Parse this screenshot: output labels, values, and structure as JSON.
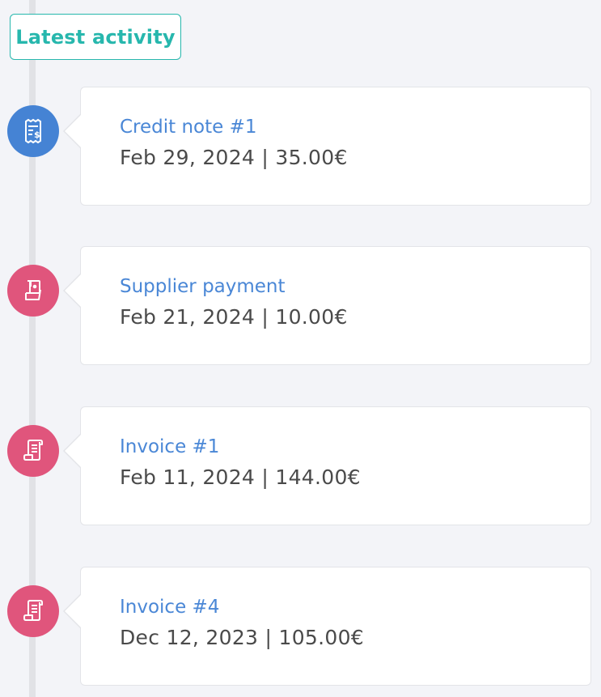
{
  "header": {
    "title": "Latest activity"
  },
  "colors": {
    "accent": "#27b7ad",
    "blue_icon": "#4583d4",
    "pink_icon": "#e0557c",
    "link": "#4a87d6",
    "text": "#4a4a4a"
  },
  "activities": [
    {
      "icon": "receipt-dollar-icon",
      "icon_color": "#4583d4",
      "title": "Credit note #1",
      "date": "Feb 29, 2024",
      "separator": "|",
      "amount": "35.00€"
    },
    {
      "icon": "hand-money-icon",
      "icon_color": "#e0557c",
      "title": "Supplier payment",
      "date": "Feb 21, 2024",
      "separator": "|",
      "amount": "10.00€"
    },
    {
      "icon": "scroll-invoice-icon",
      "icon_color": "#e0557c",
      "title": "Invoice #1",
      "date": "Feb 11, 2024",
      "separator": "|",
      "amount": "144.00€"
    },
    {
      "icon": "scroll-invoice-icon",
      "icon_color": "#e0557c",
      "title": "Invoice #4",
      "date": "Dec 12, 2023",
      "separator": "|",
      "amount": "105.00€"
    }
  ]
}
